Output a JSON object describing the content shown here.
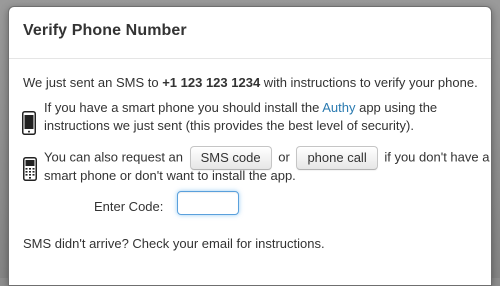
{
  "dialog": {
    "title": "Verify Phone Number"
  },
  "intro": {
    "prefix": "We just sent an SMS to ",
    "phone": "+1 123 123 1234",
    "suffix": " with instructions to verify your phone."
  },
  "smartphone": {
    "icon": "smartphone-icon",
    "line1_prefix": "If you have a smart phone you should install the ",
    "app_link": "Authy",
    "line1_suffix": " app using the",
    "line2": "instructions we just sent (this provides the best level of security)."
  },
  "request": {
    "icon": "feature-phone-icon",
    "line1_prefix": "You can also request an",
    "sms_button": "SMS code",
    "or_text": "or",
    "call_button": "phone call",
    "line1_suffix": "if you don't have a",
    "line2": "smart phone or don't want to install the app."
  },
  "code": {
    "label": "Enter Code:",
    "value": "",
    "placeholder": ""
  },
  "footer": {
    "note": "SMS didn't arrive? Check your email for instructions."
  },
  "colors": {
    "link": "#2a7ab0",
    "focus": "#5aa0dc",
    "overlay": "#8e8e8e"
  }
}
